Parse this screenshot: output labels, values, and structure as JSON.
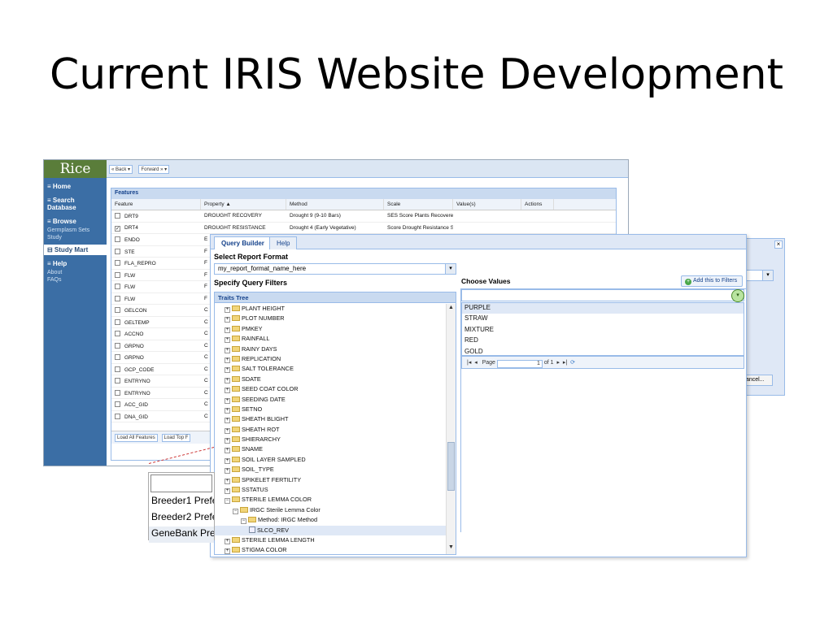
{
  "slide": {
    "title": "Current IRIS Website Development"
  },
  "sidebar": {
    "logo": "Rice",
    "items": [
      {
        "label": "≡ Home",
        "kind": "head"
      },
      {
        "label": "≡ Search Database",
        "kind": "head"
      },
      {
        "label": "≡ Browse",
        "kind": "head"
      },
      {
        "label": "Germplasm Sets",
        "kind": "sub"
      },
      {
        "label": "Study",
        "kind": "sub"
      },
      {
        "label": "⊟ Study Mart",
        "kind": "active"
      },
      {
        "label": "≡ Help",
        "kind": "head"
      },
      {
        "label": "About",
        "kind": "sub"
      },
      {
        "label": "FAQs",
        "kind": "sub"
      }
    ]
  },
  "topbar": {
    "back": "« Back ▾",
    "forward": "Forward » ▾"
  },
  "features": {
    "title": "Features",
    "columns": [
      "Feature",
      "Property ▲",
      "Method",
      "Scale",
      "Value(s)",
      "Actions"
    ],
    "rows": [
      {
        "feature": "DRT9",
        "property": "DROUGHT RECOVERY",
        "method": "Drought 9 (9-10 Bars)",
        "scale": "SES Score Plants Recovered"
      },
      {
        "feature": "DRT4",
        "property": "DROUGHT RESISTANCE",
        "method": "Drought 4 (Early Vegetative)",
        "scale": "Score Drought Resistance Sc",
        "checked": true
      },
      {
        "feature": "ENDO",
        "property": "E"
      },
      {
        "feature": "STE",
        "property": "F"
      },
      {
        "feature": "FLA_REPRO",
        "property": "F"
      },
      {
        "feature": "FLW",
        "property": "F"
      },
      {
        "feature": "FLW",
        "property": "F"
      },
      {
        "feature": "FLW",
        "property": "F"
      },
      {
        "feature": "GELCON",
        "property": "C"
      },
      {
        "feature": "GELTEMP",
        "property": "C"
      },
      {
        "feature": "ACCNO",
        "property": "C"
      },
      {
        "feature": "GRPNO",
        "property": "C"
      },
      {
        "feature": "GRPNO",
        "property": "C"
      },
      {
        "feature": "GCP_CODE",
        "property": "C"
      },
      {
        "feature": "ENTRYNO",
        "property": "C"
      },
      {
        "feature": "ENTRYNO",
        "property": "C"
      },
      {
        "feature": "ACC_GID",
        "property": "C"
      },
      {
        "feature": "DNA_GID",
        "property": "C"
      }
    ],
    "footer_buttons": [
      "Load All Features",
      "Load Top F"
    ]
  },
  "query_builder": {
    "tabs": [
      "Query Builder",
      "Help"
    ],
    "select_format_label": "Select Report Format",
    "format_value": "my_report_format_name_here",
    "filters_label": "Specify Query Filters",
    "tree_title": "Traits Tree",
    "tree_nodes": [
      {
        "label": "PLANT HEIGHT",
        "depth": 0,
        "type": "folder"
      },
      {
        "label": "PLOT NUMBER",
        "depth": 0,
        "type": "folder"
      },
      {
        "label": "PMKEY",
        "depth": 0,
        "type": "folder"
      },
      {
        "label": "RAINFALL",
        "depth": 0,
        "type": "folder"
      },
      {
        "label": "RAINY DAYS",
        "depth": 0,
        "type": "folder"
      },
      {
        "label": "REPLICATION",
        "depth": 0,
        "type": "folder"
      },
      {
        "label": "SALT TOLERANCE",
        "depth": 0,
        "type": "folder"
      },
      {
        "label": "SDATE",
        "depth": 0,
        "type": "folder"
      },
      {
        "label": "SEED COAT COLOR",
        "depth": 0,
        "type": "folder"
      },
      {
        "label": "SEEDING DATE",
        "depth": 0,
        "type": "folder"
      },
      {
        "label": "SETNO",
        "depth": 0,
        "type": "folder"
      },
      {
        "label": "SHEATH BLIGHT",
        "depth": 0,
        "type": "folder"
      },
      {
        "label": "SHEATH ROT",
        "depth": 0,
        "type": "folder"
      },
      {
        "label": "SHIERARCHY",
        "depth": 0,
        "type": "folder"
      },
      {
        "label": "SNAME",
        "depth": 0,
        "type": "folder"
      },
      {
        "label": "SOIL LAYER SAMPLED",
        "depth": 0,
        "type": "folder"
      },
      {
        "label": "SOIL_TYPE",
        "depth": 0,
        "type": "folder"
      },
      {
        "label": "SPIKELET FERTILITY",
        "depth": 0,
        "type": "folder"
      },
      {
        "label": "SSTATUS",
        "depth": 0,
        "type": "folder"
      },
      {
        "label": "STERILE LEMMA COLOR",
        "depth": 0,
        "type": "folder",
        "expanded": true
      },
      {
        "label": "IRGC Sterile Lemma Color",
        "depth": 1,
        "type": "folder",
        "expanded": true
      },
      {
        "label": "Method: IRGC Method",
        "depth": 2,
        "type": "folder",
        "expanded": true
      },
      {
        "label": "SLCO_REV",
        "depth": 3,
        "type": "leaf",
        "selected": true
      },
      {
        "label": "STERILE LEMMA LENGTH",
        "depth": 0,
        "type": "folder"
      },
      {
        "label": "STIGMA COLOR",
        "depth": 0,
        "type": "folder"
      }
    ],
    "choose_values_label": "Choose Values",
    "add_button": "Add this to Filters",
    "values": [
      "PURPLE",
      "STRAW",
      "MIXTURE",
      "RED",
      "GOLD"
    ],
    "pager": {
      "page_label": "Page",
      "page_value": "1",
      "of_label": "of 1"
    }
  },
  "dialog": {
    "close": "×",
    "cancel": "ancel..."
  },
  "preferences": {
    "items": [
      "Breeder1 Prefe",
      "Breeder2 Prefe",
      "GeneBank Pref"
    ]
  }
}
